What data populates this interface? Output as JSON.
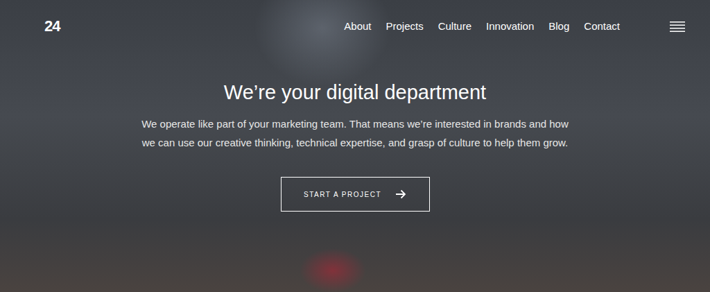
{
  "logo": "24",
  "nav": {
    "items": [
      {
        "label": "About"
      },
      {
        "label": "Projects"
      },
      {
        "label": "Culture"
      },
      {
        "label": "Innovation"
      },
      {
        "label": "Blog"
      },
      {
        "label": "Contact"
      }
    ]
  },
  "hero": {
    "title": "We’re your digital department",
    "text": "We operate like part of your marketing team. That means we’re interested in brands and how we can use our creative thinking, technical expertise, and grasp of culture to help them grow.",
    "button": "START A PROJECT"
  }
}
